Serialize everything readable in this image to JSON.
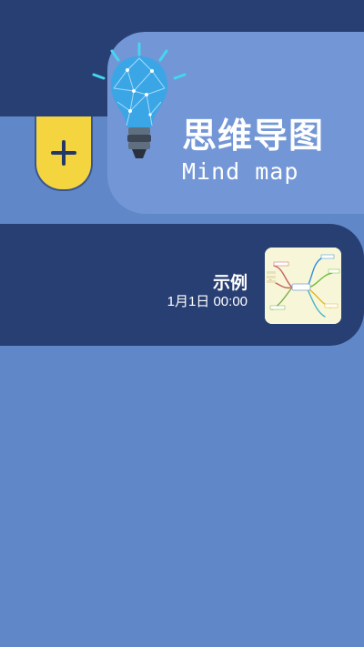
{
  "header": {
    "title_cn": "思维导图",
    "title_en": "Mind map"
  },
  "add_button": {
    "icon": "plus-icon",
    "color": "#f4d540"
  },
  "documents": [
    {
      "title": "示例",
      "date": "1月1日 00:00",
      "thumbnail": "mind-map-thumbnail"
    }
  ],
  "colors": {
    "background": "#6088c8",
    "dark_blue": "#283f73",
    "header_card": "#7296d6",
    "accent_yellow": "#f4d540"
  }
}
